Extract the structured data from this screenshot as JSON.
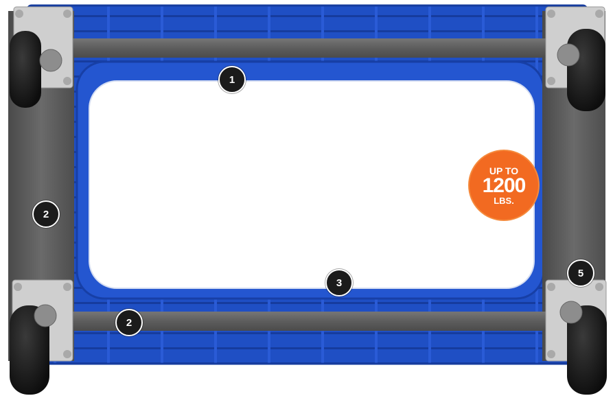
{
  "product": {
    "frame_color": "#1f4fc4",
    "rail_color": "#5f5f5f",
    "wheel_color": "#1a1a1a",
    "plate_color": "#c9c9c9"
  },
  "capacity_badge": {
    "line1": "UP TO",
    "line2": "1200",
    "line3": "LBS.",
    "color": "#f26a21"
  },
  "callouts": [
    {
      "label": "1"
    },
    {
      "label": "2"
    },
    {
      "label": "2"
    },
    {
      "label": "3"
    },
    {
      "label": "5"
    }
  ]
}
